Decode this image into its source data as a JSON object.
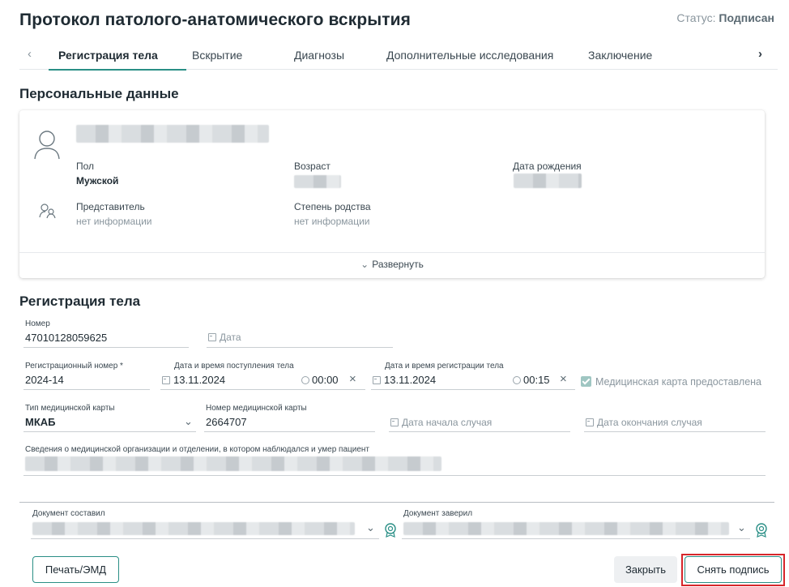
{
  "header": {
    "title": "Протокол патолого-анатомического вскрытия",
    "status_label": "Статус:",
    "status_value": "Подписан"
  },
  "tabs": [
    {
      "label": "Регистрация тела",
      "active": true
    },
    {
      "label": "Вскрытие",
      "active": false
    },
    {
      "label": "Диагнозы",
      "active": false
    },
    {
      "label": "Дополнительные исследования",
      "active": false
    },
    {
      "label": "Заключение",
      "active": false
    }
  ],
  "personal": {
    "section_title": "Персональные данные",
    "sex_label": "Пол",
    "sex_value": "Мужской",
    "age_label": "Возраст",
    "birth_label": "Дата рождения",
    "rep_label": "Представитель",
    "rep_value": "нет информации",
    "kinship_label": "Степень родства",
    "kinship_value": "нет информации",
    "expand_label": "Развернуть"
  },
  "registration": {
    "section_title": "Регистрация тела",
    "number_label": "Номер",
    "number_value": "47010128059625",
    "date_placeholder": "Дата",
    "reg_number_label": "Регистрационный номер *",
    "reg_number_value": "2024-14",
    "arrival_label": "Дата и время поступления тела",
    "arrival_date": "13.11.2024",
    "arrival_time": "00:00",
    "reg_dt_label": "Дата и время регистрации тела",
    "reg_date": "13.11.2024",
    "reg_time": "00:15",
    "med_card_provided": "Медицинская карта предоставлена",
    "card_type_label": "Тип медицинской карты",
    "card_type_value": "МКАБ",
    "card_number_label": "Номер медицинской карты",
    "card_number_value": "2664707",
    "case_start_placeholder": "Дата начала случая",
    "case_end_placeholder": "Дата окончания случая",
    "org_info_label": "Сведения о медицинской организации и отделении, в котором наблюдался и умер пациент"
  },
  "documents": {
    "composed_label": "Документ составил",
    "certified_label": "Документ заверил"
  },
  "footer": {
    "print_label": "Печать/ЭМД",
    "close_label": "Закрыть",
    "unsign_label": "Снять подпись"
  },
  "colors": {
    "accent": "#2a8f86",
    "highlight": "#d7262b"
  }
}
